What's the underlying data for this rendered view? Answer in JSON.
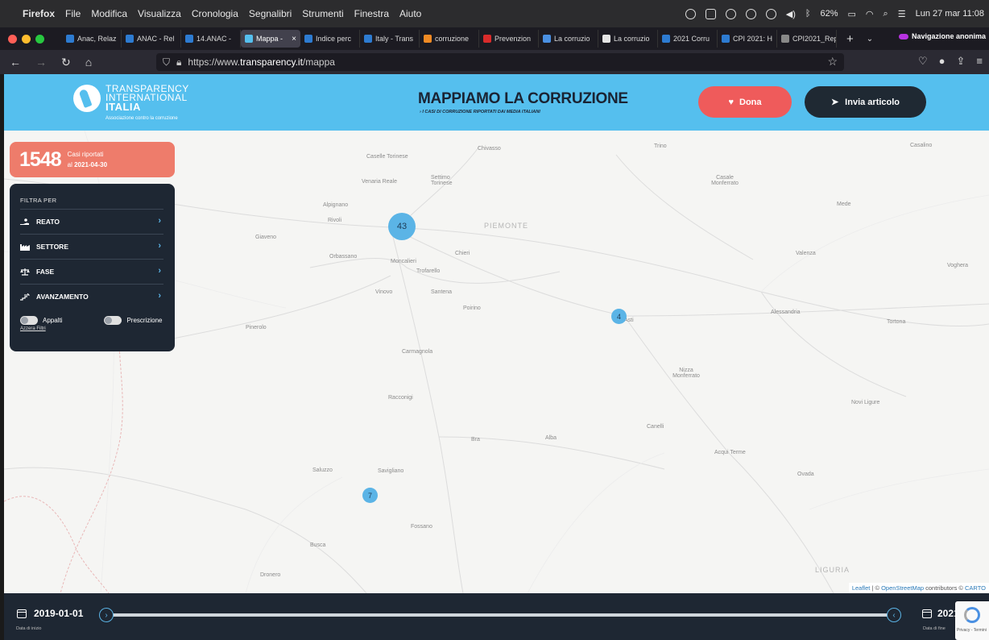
{
  "menubar": {
    "apple": "",
    "items": [
      "Firefox",
      "File",
      "Modifica",
      "Visualizza",
      "Cronologia",
      "Segnalibri",
      "Strumenti",
      "Finestra",
      "Aiuto"
    ],
    "battery": "62%",
    "clock": "Lun 27 mar 11:08"
  },
  "tabs": [
    {
      "label": "Anac, Relaz",
      "color": "#2d7bd1"
    },
    {
      "label": "ANAC - Rel",
      "color": "#2d7bd1"
    },
    {
      "label": "14.ANAC - ",
      "color": "#2d7bd1"
    },
    {
      "label": "Mappa - ",
      "color": "#55bfee",
      "active": true
    },
    {
      "label": "Indice perc",
      "color": "#2d7bd1"
    },
    {
      "label": "Italy - Trans",
      "color": "#2d7bd1"
    },
    {
      "label": "corruzione",
      "color": "#f08a24"
    },
    {
      "label": "Prevenzion",
      "color": "#d92b2b"
    },
    {
      "label": "La corruzio",
      "color": "#4a90e2"
    },
    {
      "label": "La corruzio",
      "color": "#e5e5e5"
    },
    {
      "label": "2021 Corru",
      "color": "#2d7bd1"
    },
    {
      "label": "CPI 2021: H",
      "color": "#2d7bd1"
    },
    {
      "label": "CPI2021_Repo",
      "color": "#888888"
    }
  ],
  "browser": {
    "private_label": "Navigazione anonima",
    "url_prefix": "https://www.",
    "url_host": "transparency.it",
    "url_path": "/mappa"
  },
  "header": {
    "logo_line1": "TRANSPARENCY",
    "logo_line2": "INTERNATIONAL",
    "logo_line3": "ITALIA",
    "logo_sub": "Associazione contro la corruzione",
    "title": "MAPPIAMO LA CORRUZIONE",
    "subtitle": "I CASI DI CORRUZIONE RIPORTATI DAI MEDIA ITALIANI",
    "dona_label": "Dona",
    "invia_label": "Invia articolo"
  },
  "counter": {
    "count": "1548",
    "label": "Casi riportati",
    "date_prefix": "al",
    "date": "2021-04-30"
  },
  "filters": {
    "title": "FILTRA PER",
    "items": [
      {
        "label": "REATO",
        "icon": "hand-coin-icon"
      },
      {
        "label": "SETTORE",
        "icon": "factory-icon"
      },
      {
        "label": "FASE",
        "icon": "scales-icon"
      },
      {
        "label": "AVANZAMENTO",
        "icon": "hand-stairs-icon"
      }
    ],
    "toggle_appalti": "Appalti",
    "toggle_prescrizione": "Prescrizione",
    "reset_label": "Azzera Filtri"
  },
  "map": {
    "places": [
      "Chivasso",
      "Trino",
      "Casalino",
      "Caselle Torinese",
      "Settimo Torinese",
      "Venaria Reale",
      "Casale Monferrato",
      "Mede",
      "Alpignano",
      "Rivoli",
      "Giaveno",
      "Orbassano",
      "Moncalieri",
      "Trofarello",
      "Chieri",
      "Valenza",
      "Voghera",
      "Vinovo",
      "Santena",
      "Poirino",
      "Asti",
      "Alessandria",
      "Tortona",
      "Pinerolo",
      "Carmagnola",
      "Nizza Monferrato",
      "Racconigi",
      "Novi Ligure",
      "Canelli",
      "Bra",
      "Alba",
      "Acqui Terme",
      "Saluzzo",
      "Savigliano",
      "Ovada",
      "Fossano",
      "Busca",
      "Dronero"
    ],
    "regions": [
      "PIEMONTE",
      "LIGURIA"
    ],
    "clusters": [
      "43",
      "4",
      "7"
    ],
    "attribution_leaflet": "Leaflet",
    "attribution_sep": " | © ",
    "attribution_osm": "OpenStreetMap",
    "attribution_rest": " contributors © ",
    "attribution_carto": "CARTO"
  },
  "timeline": {
    "start_date": "2019-01-01",
    "start_caption": "Data di inizio",
    "end_date": "2021",
    "end_caption": "Data di fine"
  },
  "recaptcha": {
    "text": "Privacy - Termini"
  }
}
